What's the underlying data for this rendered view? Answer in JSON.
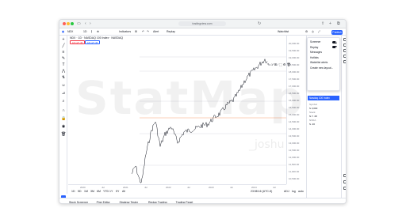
{
  "browser": {
    "url": "tradingview.com"
  },
  "toolbar": {
    "symbol": "NDX",
    "interval": "1D",
    "indicators": "Indicators",
    "alert": "Alert",
    "replay": "Replay",
    "publish": "Publish",
    "watchlist": "Watchlist"
  },
  "chart": {
    "symbol_line": "NDX · 1D · NASDAQ 100 Index · NASDAQ",
    "sell_box": "18,127.45",
    "buy_box": "18,127.45",
    "watermark_main": "StatMap",
    "watermark_sub": "_joshu"
  },
  "price_axis": [
    "20,000.00",
    "19,500.00",
    "19,000.00",
    "18,500.00",
    "18,000.00",
    "17,500.00",
    "17,000.00",
    "16,500.00",
    "16,000.00",
    "15,500.00",
    "15,000.00",
    "14,500.00",
    "14,000.00",
    "13,500.00",
    "13,000.00",
    "12,500.00",
    "12,000.00",
    "11,500.00",
    "11,000.00",
    "10,500.00"
  ],
  "time_axis": [
    "2020",
    "Jul",
    "2021",
    "Jul",
    "2022",
    "Jul",
    "2023",
    "Jul",
    "2024",
    "Jul"
  ],
  "range_bar": {
    "ranges": [
      "1D",
      "5D",
      "1M",
      "3M",
      "6M",
      "YTD",
      "1Y",
      "5Y",
      "All"
    ],
    "time": "23:58:16 (UTC-5)",
    "adj": "ADJ",
    "log": "log",
    "auto": "auto"
  },
  "bottom_bar": [
    "Stock Screener",
    "Pine Editor",
    "Strategy Tester",
    "Replay Trading",
    "Trading Panel"
  ],
  "menu": {
    "items": [
      "Screener",
      "Replay",
      "Messages",
      "Hotlists",
      "Watchlist alerts",
      "Create new layout..."
    ],
    "toggles": [
      "Screener",
      "Replay"
    ]
  },
  "watchlist": {
    "selected": "Nasdaq 100 Index",
    "rows": [
      {
        "label": "Symbol",
        "value": ""
      },
      {
        "label": "S 3,000",
        "value": ""
      },
      {
        "label": "Stock",
        "value": ""
      },
      {
        "label": "N.Y. 48",
        "value": ""
      },
      {
        "label": "NVDA",
        "value": ""
      },
      {
        "label": "S. 20",
        "value": ""
      }
    ]
  },
  "colors": {
    "accent": "#2962ff",
    "sell": "#f23645",
    "line": "#131722"
  }
}
